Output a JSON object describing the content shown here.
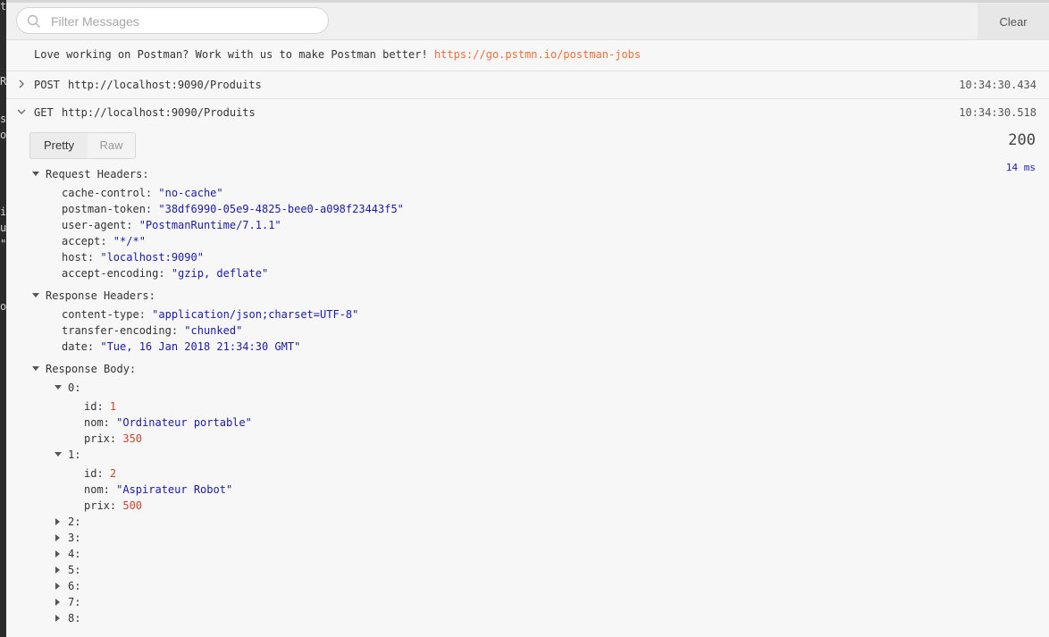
{
  "left_strip": [
    "t",
    "R",
    "s",
    "o",
    "i",
    "u",
    "\"",
    "o"
  ],
  "search": {
    "placeholder": "Filter Messages"
  },
  "toolbar": {
    "clear_label": "Clear"
  },
  "banner": {
    "text": "Love working on Postman? Work with us to make Postman better! ",
    "link": "https://go.pstmn.io/postman-jobs"
  },
  "requests": [
    {
      "method": "POST",
      "url": "http://localhost:9090/Produits",
      "time": "10:34:30.434",
      "expanded": false
    },
    {
      "method": "GET",
      "url": "http://localhost:9090/Produits",
      "time": "10:34:30.518",
      "expanded": true
    }
  ],
  "view_tabs": {
    "pretty": "Pretty",
    "raw": "Raw"
  },
  "response": {
    "status": "200",
    "duration": "14 ms"
  },
  "request_headers": {
    "label": "Request Headers:",
    "items": [
      {
        "key": "cache-control",
        "value": "\"no-cache\""
      },
      {
        "key": "postman-token",
        "value": "\"38df6990-05e9-4825-bee0-a098f23443f5\""
      },
      {
        "key": "user-agent",
        "value": "\"PostmanRuntime/7.1.1\""
      },
      {
        "key": "accept",
        "value": "\"*/*\""
      },
      {
        "key": "host",
        "value": "\"localhost:9090\""
      },
      {
        "key": "accept-encoding",
        "value": "\"gzip, deflate\""
      }
    ]
  },
  "response_headers": {
    "label": "Response Headers:",
    "items": [
      {
        "key": "content-type",
        "value": "\"application/json;charset=UTF-8\""
      },
      {
        "key": "transfer-encoding",
        "value": "\"chunked\""
      },
      {
        "key": "date",
        "value": "\"Tue, 16 Jan 2018 21:34:30 GMT\""
      }
    ]
  },
  "response_body": {
    "label": "Response Body:",
    "items": [
      {
        "index": "0:",
        "expanded": true,
        "fields": [
          {
            "key": "id",
            "value": "1",
            "type": "num"
          },
          {
            "key": "nom",
            "value": "\"Ordinateur portable\"",
            "type": "str"
          },
          {
            "key": "prix",
            "value": "350",
            "type": "num"
          }
        ]
      },
      {
        "index": "1:",
        "expanded": true,
        "fields": [
          {
            "key": "id",
            "value": "2",
            "type": "num"
          },
          {
            "key": "nom",
            "value": "\"Aspirateur Robot\"",
            "type": "str"
          },
          {
            "key": "prix",
            "value": "500",
            "type": "num"
          }
        ]
      },
      {
        "index": "2:",
        "expanded": false,
        "fields": []
      },
      {
        "index": "3:",
        "expanded": false,
        "fields": []
      },
      {
        "index": "4:",
        "expanded": false,
        "fields": []
      },
      {
        "index": "5:",
        "expanded": false,
        "fields": []
      },
      {
        "index": "6:",
        "expanded": false,
        "fields": []
      },
      {
        "index": "7:",
        "expanded": false,
        "fields": []
      },
      {
        "index": "8:",
        "expanded": false,
        "fields": []
      }
    ]
  }
}
